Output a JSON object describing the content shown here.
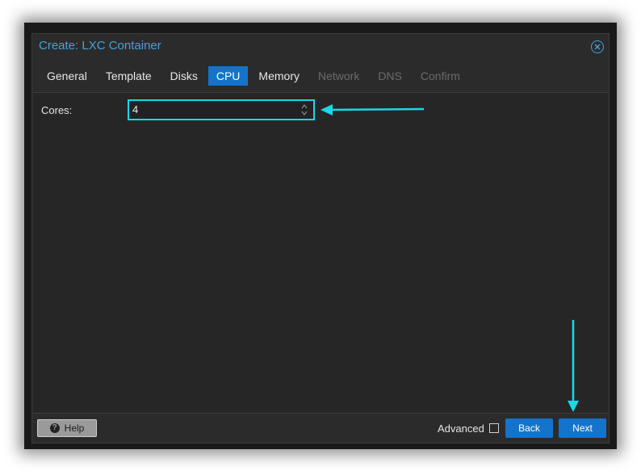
{
  "dialog": {
    "title": "Create: LXC Container"
  },
  "tabs": [
    {
      "label": "General",
      "state": "enabled"
    },
    {
      "label": "Template",
      "state": "enabled"
    },
    {
      "label": "Disks",
      "state": "enabled"
    },
    {
      "label": "CPU",
      "state": "active"
    },
    {
      "label": "Memory",
      "state": "enabled"
    },
    {
      "label": "Network",
      "state": "disabled"
    },
    {
      "label": "DNS",
      "state": "disabled"
    },
    {
      "label": "Confirm",
      "state": "disabled"
    }
  ],
  "form": {
    "cores_label": "Cores:",
    "cores_value": "4"
  },
  "footer": {
    "help_label": "Help",
    "advanced_label": "Advanced",
    "back_label": "Back",
    "next_label": "Next"
  },
  "colors": {
    "accent": "#1474cc",
    "title": "#3fa5de",
    "annotation_arrow": "#19d8e8"
  }
}
